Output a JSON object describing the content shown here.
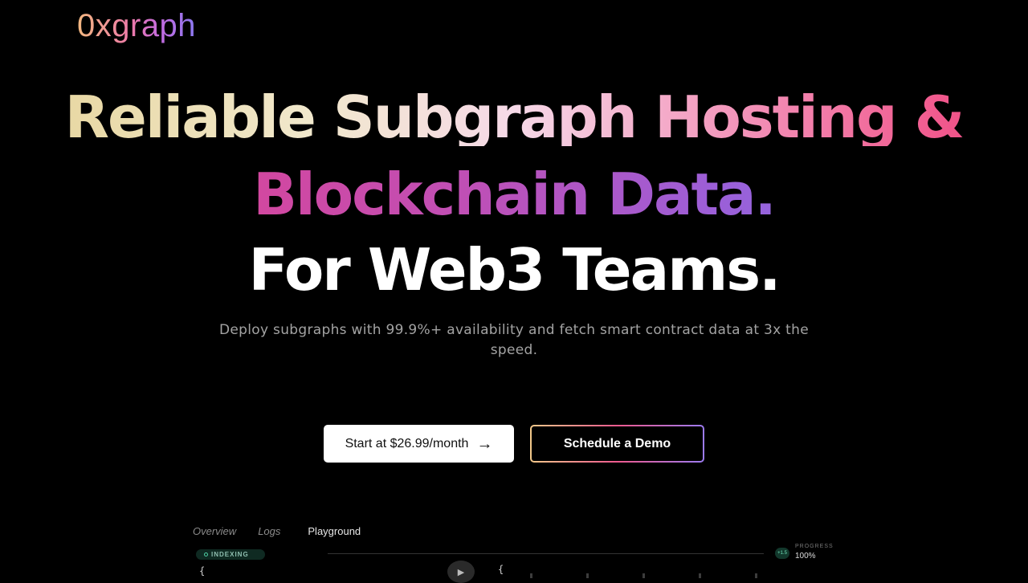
{
  "brand": {
    "logo_text": "0xgraph"
  },
  "hero": {
    "line1_part1": "Reliable Subgraph Hosting &",
    "line2": "Blockchain Data.",
    "line3": "For Web3 Teams.",
    "subtitle": "Deploy subgraphs with 99.9%+ availability and fetch smart contract data at 3x the speed."
  },
  "cta": {
    "primary_label": "Start at $26.99/month",
    "primary_icon": "arrow-right-icon",
    "secondary_label": "Schedule a Demo"
  },
  "preview": {
    "tabs": [
      {
        "label": "Overview",
        "active": false
      },
      {
        "label": "Logs",
        "active": false
      },
      {
        "label": "Playground",
        "active": true
      }
    ],
    "status": "INDEXING",
    "progress_icon_text": "+1.5",
    "progress_label": "PROGRESS",
    "progress_value": "100%",
    "code_open_left": "{",
    "code_open_right": "{"
  },
  "colors": {
    "background": "#000000",
    "accent_pink": "#f0407a",
    "accent_purple": "#7c7bf0",
    "accent_gold": "#e6d49a"
  }
}
